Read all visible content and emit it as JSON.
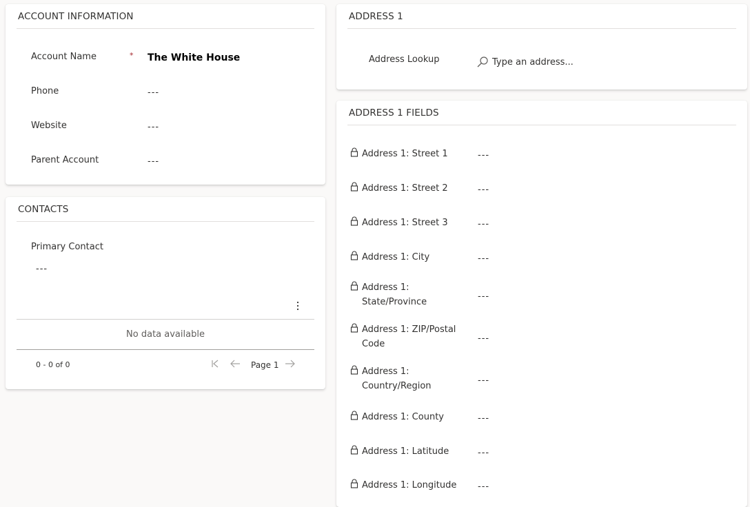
{
  "account_info": {
    "title": "ACCOUNT INFORMATION",
    "fields": [
      {
        "label": "Account Name",
        "value": "The White House",
        "required": true,
        "required_marker": "*"
      },
      {
        "label": "Phone",
        "value": "---"
      },
      {
        "label": "Website",
        "value": "---"
      },
      {
        "label": "Parent Account",
        "value": "---"
      }
    ]
  },
  "contacts": {
    "title": "CONTACTS",
    "primary_contact_label": "Primary Contact",
    "primary_contact_value": "---",
    "more_icon": "more-vertical-icon",
    "empty_message": "No data available",
    "record_count": "0 - 0 of 0",
    "page_label": "Page 1"
  },
  "address1": {
    "title": "ADDRESS 1",
    "lookup_label": "Address Lookup",
    "lookup_placeholder": "Type an address..."
  },
  "address1_fields": {
    "title": "ADDRESS 1 FIELDS",
    "fields": [
      {
        "label": "Address 1: Street 1",
        "value": "---"
      },
      {
        "label": "Address 1: Street 2",
        "value": "---"
      },
      {
        "label": "Address 1: Street 3",
        "value": "---"
      },
      {
        "label": "Address 1: City",
        "value": "---"
      },
      {
        "label": "Address 1: State/Province",
        "value": "---"
      },
      {
        "label": "Address 1: ZIP/Postal Code",
        "value": "---"
      },
      {
        "label": "Address 1: Country/Region",
        "value": "---"
      },
      {
        "label": "Address 1: County",
        "value": "---"
      },
      {
        "label": "Address 1: Latitude",
        "value": "---"
      },
      {
        "label": "Address 1: Longitude",
        "value": "---"
      }
    ]
  },
  "colors": {
    "page_background": "#faf9f8",
    "card_background": "#ffffff",
    "required_marker": "#a4262c",
    "divider": "#e1dfdd"
  }
}
